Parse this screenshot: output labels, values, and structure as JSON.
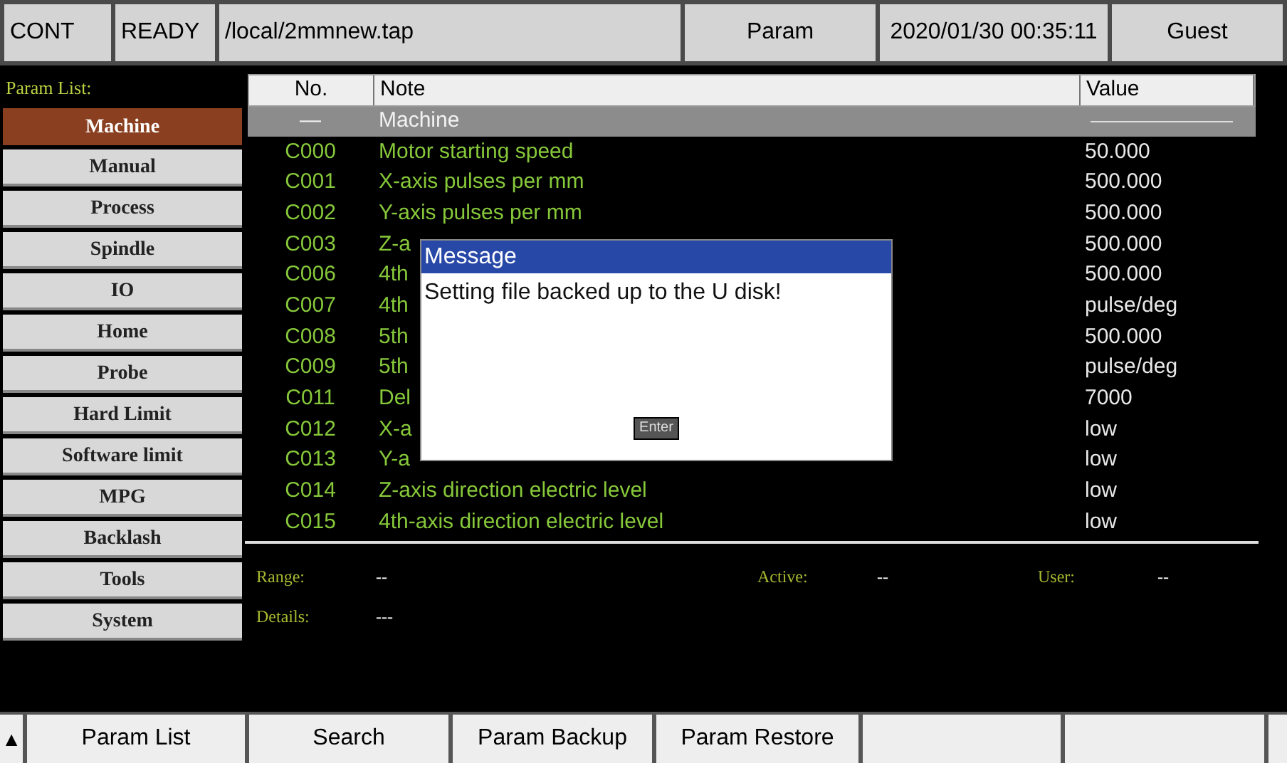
{
  "status_bar": {
    "mode": "CONT",
    "state": "READY",
    "file": "/local/2mmnew.tap",
    "screen": "Param",
    "datetime": "2020/01/30 00:35:11",
    "user": "Guest"
  },
  "sidebar": {
    "title": "Param List:",
    "items": [
      {
        "label": "Machine",
        "selected": true
      },
      {
        "label": "Manual",
        "selected": false
      },
      {
        "label": "Process",
        "selected": false
      },
      {
        "label": "Spindle",
        "selected": false
      },
      {
        "label": "IO",
        "selected": false
      },
      {
        "label": "Home",
        "selected": false
      },
      {
        "label": "Probe",
        "selected": false
      },
      {
        "label": "Hard Limit",
        "selected": false
      },
      {
        "label": "Software limit",
        "selected": false
      },
      {
        "label": "MPG",
        "selected": false
      },
      {
        "label": "Backlash",
        "selected": false
      },
      {
        "label": "Tools",
        "selected": false
      },
      {
        "label": "System",
        "selected": false
      }
    ]
  },
  "table": {
    "columns": [
      "No.",
      "Note",
      "Value"
    ],
    "rows": [
      {
        "kind": "group",
        "no": "—",
        "note": "Machine"
      },
      {
        "kind": "param",
        "no": "C000",
        "note": "Motor starting speed",
        "value": "50.000"
      },
      {
        "kind": "param",
        "no": "C001",
        "note": "X-axis pulses per mm",
        "value": "500.000"
      },
      {
        "kind": "param",
        "no": "C002",
        "note": "Y-axis pulses per mm",
        "value": "500.000"
      },
      {
        "kind": "param",
        "no": "C003",
        "note": "Z-a",
        "value": "500.000"
      },
      {
        "kind": "param",
        "no": "C006",
        "note": "4th",
        "value": "500.000"
      },
      {
        "kind": "param",
        "no": "C007",
        "note": "4th",
        "value": "pulse/deg"
      },
      {
        "kind": "param",
        "no": "C008",
        "note": "5th",
        "value": "500.000"
      },
      {
        "kind": "param",
        "no": "C009",
        "note": "5th",
        "value": "pulse/deg"
      },
      {
        "kind": "param",
        "no": "C011",
        "note": "Del",
        "value": "7000"
      },
      {
        "kind": "param",
        "no": "C012",
        "note": "X-a",
        "value": "low"
      },
      {
        "kind": "param",
        "no": "C013",
        "note": "Y-a",
        "value": "low"
      },
      {
        "kind": "param",
        "no": "C014",
        "note": "Z-axis direction electric level",
        "value": "low"
      },
      {
        "kind": "param",
        "no": "C015",
        "note": "4th-axis direction electric level",
        "value": "low"
      }
    ]
  },
  "details": {
    "fields": [
      {
        "label": "Range:",
        "value": "--"
      },
      {
        "label": "Active:",
        "value": "--"
      },
      {
        "label": "User:",
        "value": "--"
      }
    ],
    "details_label": "Details:",
    "details_value": "---"
  },
  "dialog": {
    "title": "Message",
    "message": "Setting file backed up to the U disk!",
    "button": "Enter"
  },
  "softkeys": {
    "arrow": "▲",
    "buttons": [
      "Param List",
      "Search",
      "Param Backup",
      "Param Restore"
    ]
  }
}
